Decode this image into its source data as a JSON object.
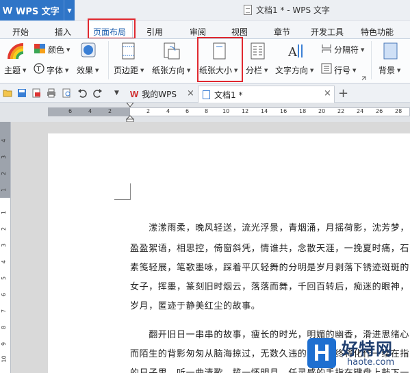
{
  "app": {
    "name": "WPS 文字",
    "logo_letter": "W"
  },
  "window": {
    "title": "文档1 * - WPS 文字"
  },
  "menu": {
    "tabs": [
      "开始",
      "插入",
      "页面布局",
      "引用",
      "审阅",
      "视图",
      "章节",
      "开发工具",
      "特色功能"
    ],
    "active": "页面布局"
  },
  "ribbon": {
    "color_label": "颜色",
    "theme_label": "主题",
    "font_label": "字体",
    "effect_label": "效果",
    "margin_label": "页边距",
    "orientation_label": "纸张方向",
    "size_label": "纸张大小",
    "columns_label": "分栏",
    "text_direction_label": "文字方向",
    "separator_label": "分隔符",
    "line_number_label": "行号",
    "background_label": "背景"
  },
  "quickbar": {
    "tabs": [
      {
        "label": "我的WPS",
        "active": false
      },
      {
        "label": "文档1 *",
        "active": true
      }
    ],
    "add_tab": "+"
  },
  "ruler": {
    "h_labels": [
      "6",
      "4",
      "2",
      "2",
      "4",
      "6",
      "8",
      "10",
      "12",
      "14",
      "16",
      "18",
      "20",
      "22",
      "24",
      "26",
      "28"
    ],
    "v_labels": [
      "4",
      "3",
      "2",
      "1",
      "1",
      "2",
      "3",
      "4",
      "5",
      "6",
      "7",
      "8",
      "9",
      "10",
      "11",
      "12"
    ]
  },
  "document": {
    "paragraph1": [
      "　　潆潆雨柔，晚风轻送，流光浮景，青烟涌，月摇荷影，沈芳梦，",
      "盈盈絮语，相思控，倚窗斜凭，情谁共，念散天涯，一挽夏时痛，石",
      "素笺轻展，笔歌墨咏，踩着平仄轻舞的分明是岁月剥落下锈迹斑斑的",
      "女子，挥墨，篆刻旧时烟云，落落而舞，千回百转后，痴迷的眼神，",
      "岁月，匿迹于静美红尘的故事。"
    ],
    "paragraph2": [
      "　　翻开旧日一串串的故事，瘦长的时光，明媚的幽香，滑进思绪心",
      "而陌生的背影匆匆从脑海掠过，无数久违的记忆，终将化作一缕在指",
      "的日子里，听一曲清歌，揽一怀明月，任灵感的手指在键盘上敲下一"
    ]
  },
  "watermark": {
    "logo_letter": "H",
    "name": "好特网",
    "url": "haote.com"
  },
  "colors": {
    "brand_blue": "#2f75c7",
    "highlight_red": "#e0282f"
  }
}
